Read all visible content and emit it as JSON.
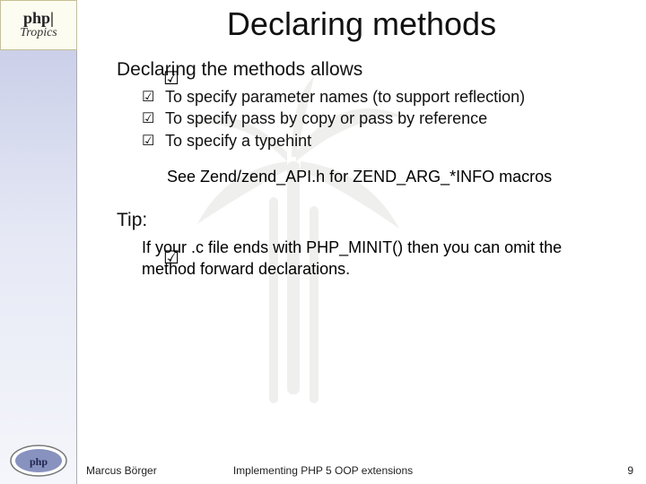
{
  "logo": {
    "php": "php",
    "bar": "|",
    "tropics": "Tropics"
  },
  "title": "Declaring methods",
  "section1": {
    "heading": "Declaring the methods allows",
    "items": [
      "To specify parameter names (to support reflection)",
      "To specify pass by copy or pass by reference",
      "To specify a typehint"
    ],
    "see": "See Zend/zend_API.h for ZEND_ARG_*INFO macros"
  },
  "section2": {
    "heading": "Tip:",
    "body": "If your .c file ends with PHP_MINIT() then you can omit the method forward declarations."
  },
  "footer": {
    "author": "Marcus Börger",
    "title": "Implementing PHP 5 OOP extensions",
    "page": "9"
  },
  "glyphs": {
    "check": "☑"
  }
}
